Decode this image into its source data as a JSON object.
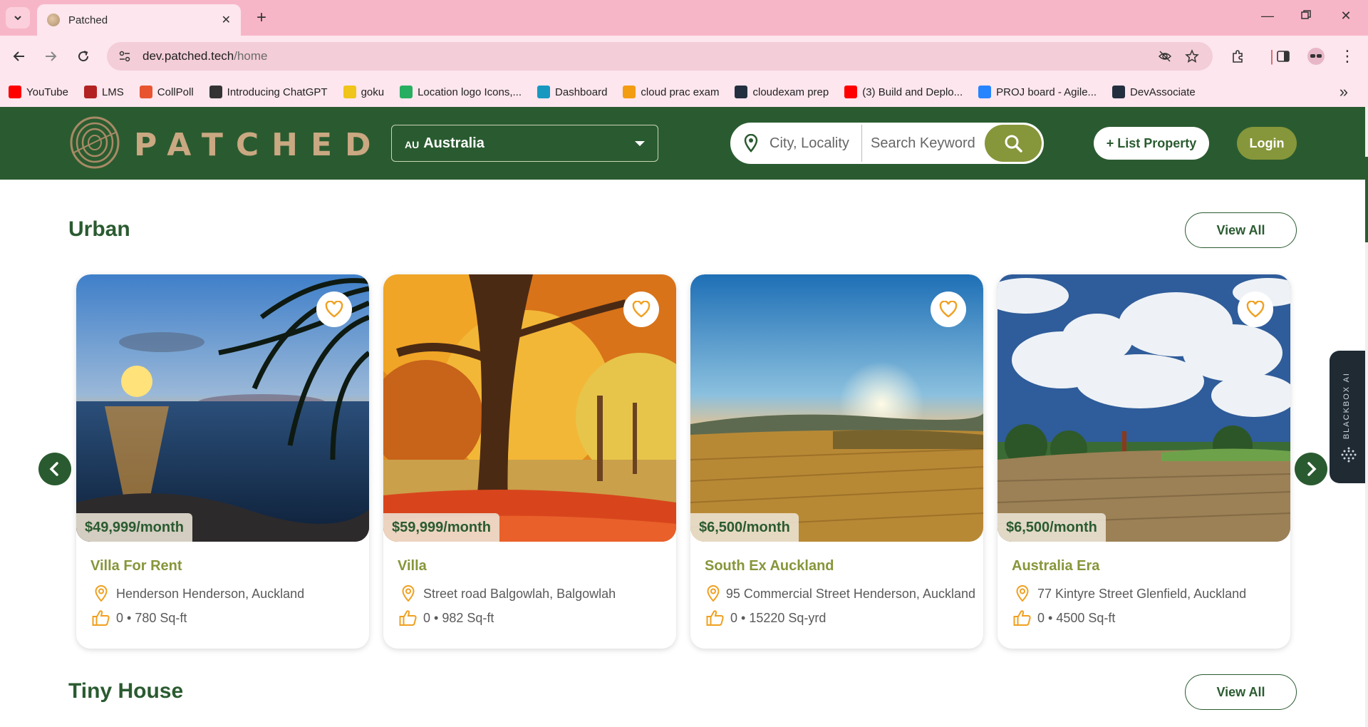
{
  "browser": {
    "tab_title": "Patched",
    "url_host": "dev.patched.tech",
    "url_path": "/home",
    "bookmarks": [
      {
        "label": "YouTube",
        "color": "#ff0000"
      },
      {
        "label": "LMS",
        "color": "#b22222"
      },
      {
        "label": "CollPoll",
        "color": "#e8542f"
      },
      {
        "label": "Introducing ChatGPT",
        "color": "#333333"
      },
      {
        "label": "goku",
        "color": "#f0c419"
      },
      {
        "label": "Location logo Icons,...",
        "color": "#27ae60"
      },
      {
        "label": "Dashboard",
        "color": "#1798c1"
      },
      {
        "label": "cloud prac exam",
        "color": "#f39c12"
      },
      {
        "label": "cloudexam prep",
        "color": "#232f3e"
      },
      {
        "label": "(3) Build and Deplo...",
        "color": "#ff0000"
      },
      {
        "label": "PROJ board - Agile...",
        "color": "#2684ff"
      },
      {
        "label": "DevAssociate",
        "color": "#232f3e"
      }
    ]
  },
  "header": {
    "logo_text": "PATCHED",
    "country_code": "AU",
    "country_name": "Australia",
    "city_placeholder": "City, Locality",
    "keyword_placeholder": "Search Keyword",
    "list_property": "+ List Property",
    "login": "Login"
  },
  "sections": {
    "urban_title": "Urban",
    "tiny_title": "Tiny House",
    "view_all": "View All"
  },
  "cards": [
    {
      "price": "$49,999/month",
      "title": "Villa For Rent",
      "address": "Henderson Henderson, Auckland",
      "meta": "0 • 780 Sq-ft",
      "scene": "beach"
    },
    {
      "price": "$59,999/month",
      "title": "Villa",
      "address": "Street road Balgowlah, Balgowlah",
      "meta": "0 • 982 Sq-ft",
      "scene": "autumn"
    },
    {
      "price": "$6,500/month",
      "title": "South Ex Auckland",
      "address": "95 Commercial Street Henderson, Auckland",
      "meta": "0 • 15220 Sq-yrd",
      "scene": "field"
    },
    {
      "price": "$6,500/month",
      "title": "Australia Era",
      "address": "77 Kintyre Street Glenfield, Auckland",
      "meta": "0 • 4500 Sq-ft",
      "scene": "clouds"
    }
  ],
  "blackbox_label": "BLACKBOX AI",
  "colors": {
    "brand_green": "#2a5b30",
    "olive": "#86963a",
    "accent_orange": "#f0a020",
    "tan": "#c9a882"
  }
}
